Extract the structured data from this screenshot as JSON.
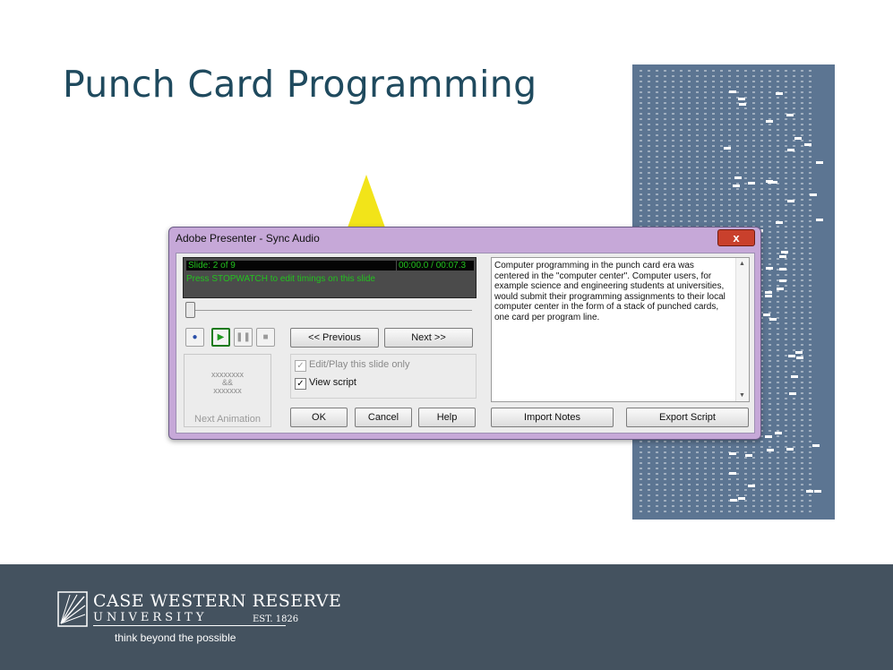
{
  "slide": {
    "title": "Punch Card Programming"
  },
  "dialog": {
    "title": "Adobe Presenter - Sync Audio",
    "close_label": "x",
    "display": {
      "slide_counter": "Slide: 2 of 9",
      "time": "00:00.0 / 00:07.3",
      "message": "Press STOPWATCH to edit timings on this slide"
    },
    "progress": 0,
    "controls": {
      "previous_label": "<< Previous",
      "next_label": "Next >>"
    },
    "next_animation_label": "Next Animation",
    "options": {
      "edit_play_label": "Edit/Play this slide only",
      "edit_play_checked": true,
      "edit_play_enabled": false,
      "view_script_label": "View script",
      "view_script_checked": true
    },
    "buttons": {
      "ok": "OK",
      "cancel": "Cancel",
      "help": "Help",
      "import_notes": "Import Notes",
      "export_script": "Export Script"
    },
    "script_text": "Computer programming in the punch card era was centered in the \"computer center\". Computer users, for example science and engineering students at universities, would submit their programming assignments to their local computer center in the form of a stack of punched cards, one card per program line."
  },
  "footer": {
    "logo_name": "CASE WESTERN RESERVE",
    "logo_university": "UNIVERSITY",
    "logo_est": "EST. 1826",
    "tagline": "think beyond the possible"
  },
  "colors": {
    "title": "#1f4a5e",
    "footer": "#44525f",
    "dialog_frame": "#c6a8d8",
    "display_text": "#22c21e",
    "beam": "#f2e419",
    "punch_card": "#5c7592"
  }
}
